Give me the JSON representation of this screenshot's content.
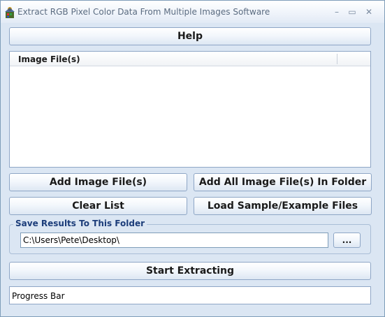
{
  "window": {
    "title": "Extract RGB Pixel Color Data From Multiple Images Software",
    "minimize_glyph": "–",
    "maximize_glyph": "▭",
    "close_glyph": "✕"
  },
  "buttons": {
    "help": "Help",
    "add_files": "Add Image File(s)",
    "add_folder": "Add All Image File(s) In Folder",
    "clear_list": "Clear List",
    "load_sample": "Load Sample/Example Files",
    "browse": "...",
    "start": "Start Extracting"
  },
  "file_list": {
    "columns": [
      "Image File(s)"
    ],
    "rows": []
  },
  "save_group": {
    "legend": "Save Results To This Folder",
    "folder_path": "C:\\Users\\Pete\\Desktop\\"
  },
  "progress": {
    "label": "Progress Bar",
    "fraction": 0
  },
  "colors": {
    "window_bg": "#dbe6f3",
    "button_border": "#8ea6c6",
    "legend_text": "#1c3d7a"
  },
  "icons": {
    "app": "app-icon"
  }
}
